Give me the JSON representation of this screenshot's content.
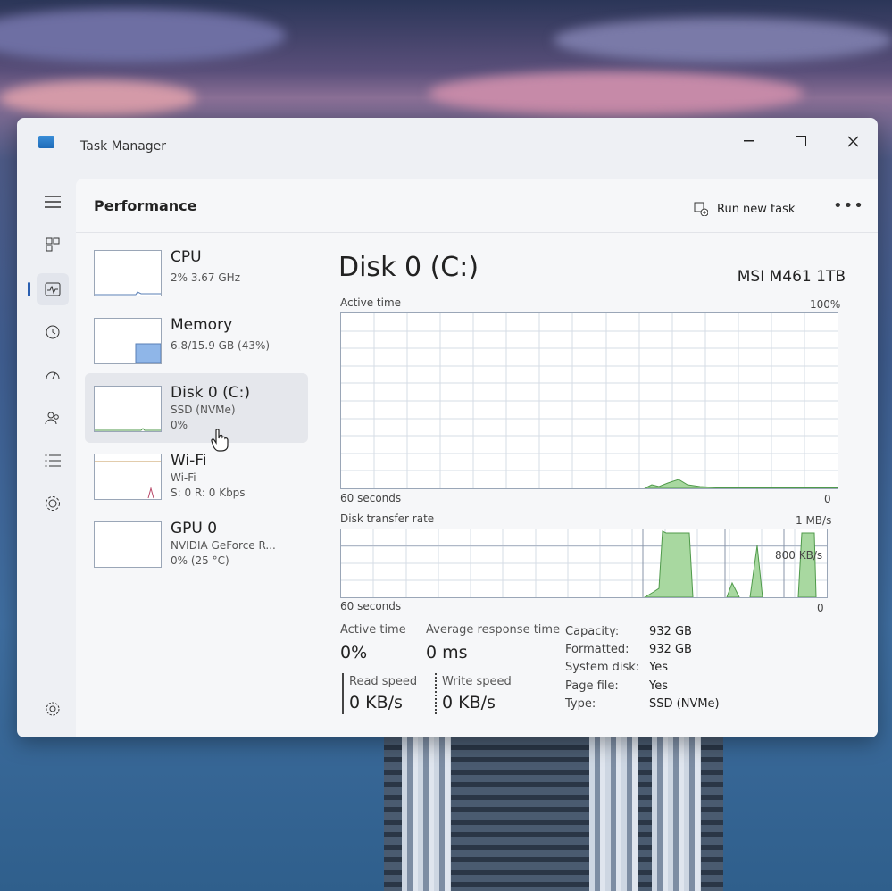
{
  "window": {
    "title": "Task Manager"
  },
  "header": {
    "title": "Performance",
    "run_task_label": "Run new task",
    "more_label": "•••"
  },
  "resources": [
    {
      "name": "CPU",
      "line1": "2% 3.67 GHz",
      "line2": ""
    },
    {
      "name": "Memory",
      "line1": "6.8/15.9 GB (43%)",
      "line2": ""
    },
    {
      "name": "Disk 0 (C:)",
      "line1": "SSD (NVMe)",
      "line2": "0%"
    },
    {
      "name": "Wi-Fi",
      "line1": "Wi-Fi",
      "line2": "S: 0 R: 0 Kbps"
    },
    {
      "name": "GPU 0",
      "line1": "NVIDIA GeForce R...",
      "line2": "0% (25 °C)"
    }
  ],
  "disk": {
    "title": "Disk 0 (C:)",
    "model": "MSI M461 1TB",
    "active_graph": {
      "label": "Active time",
      "max_label": "100%",
      "time_label": "60 seconds",
      "min_label": "0"
    },
    "transfer_graph": {
      "label": "Disk transfer rate",
      "max_label": "1 MB/s",
      "mid_label": "800 KB/s",
      "time_label": "60 seconds",
      "min_label": "0"
    },
    "stats": {
      "active_time_label": "Active time",
      "active_time_value": "0%",
      "avg_response_label": "Average response time",
      "avg_response_value": "0 ms",
      "read_speed_label": "Read speed",
      "read_speed_value": "0 KB/s",
      "write_speed_label": "Write speed",
      "write_speed_value": "0 KB/s"
    },
    "details": [
      {
        "label": "Capacity:",
        "value": "932 GB"
      },
      {
        "label": "Formatted:",
        "value": "932 GB"
      },
      {
        "label": "System disk:",
        "value": "Yes"
      },
      {
        "label": "Page file:",
        "value": "Yes"
      },
      {
        "label": "Type:",
        "value": "SSD (NVMe)"
      }
    ]
  },
  "colors": {
    "accent": "#2a5fb0",
    "disk_fill": "#a8d8a0",
    "disk_line": "#4f9a4a",
    "memory_fill": "#8fb6e8"
  },
  "icons": [
    "hamburger-icon",
    "processes-icon",
    "performance-icon",
    "app-history-icon",
    "startup-apps-icon",
    "users-icon",
    "details-icon",
    "services-icon",
    "settings-icon",
    "run-task-icon"
  ]
}
